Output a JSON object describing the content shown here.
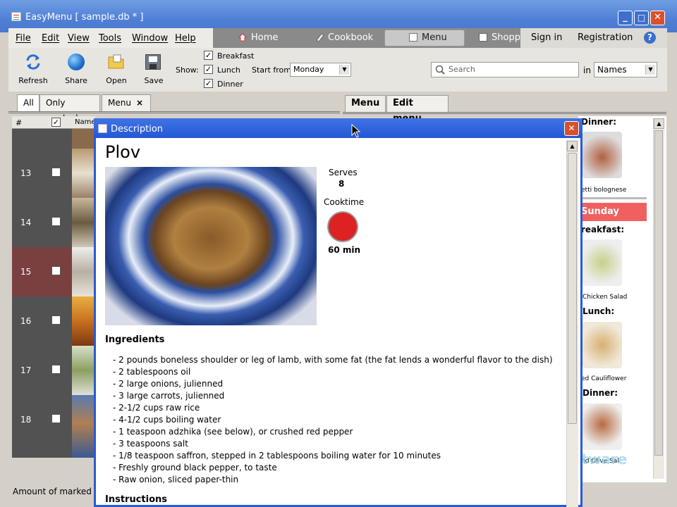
{
  "window": {
    "title": "EasyMenu [ sample.db * ]",
    "minimize": "_",
    "maximize": "□",
    "close": "✕"
  },
  "menubar": [
    "File",
    "Edit",
    "View",
    "Tools",
    "Window",
    "Help"
  ],
  "nav": {
    "home": "Home",
    "cookbook": "Cookbook",
    "menu": "Menu",
    "shopping": "Shoppin",
    "sign_in": "Sign in",
    "registration": "Registration",
    "help": "?"
  },
  "toolbar": {
    "refresh": "Refresh",
    "share": "Share",
    "open": "Open",
    "save": "Save",
    "show_label": "Show:",
    "breakfast": "Breakfast",
    "lunch": "Lunch",
    "dinner": "Dinner",
    "start_from_label": "Start from:",
    "start_from_value": "Monday",
    "search_placeholder": "Search",
    "in_label": "in",
    "in_value": "Names"
  },
  "tabs": {
    "all": "All",
    "only_marked": "Only marked",
    "menu": "Menu",
    "menu_close": "×"
  },
  "grid": {
    "col_num": "#",
    "col_check": "✓",
    "col_name": "Name",
    "rows": [
      "13",
      "14",
      "15",
      "16",
      "17",
      "18"
    ],
    "check": "✓"
  },
  "status": "Amount of marked re",
  "right_tabs": {
    "menu": "Menu",
    "edit_menu": "Edit menu"
  },
  "dialog": {
    "title": "Description",
    "close": "✕",
    "recipe_title": "Plov",
    "serves_label": "Serves",
    "serves_value": "8",
    "cooktime_label": "Cooktime",
    "cooktime_value": "60 min",
    "ingredients_heading": "Ingredients",
    "ingredients": [
      "- 2 pounds boneless shoulder or leg of lamb, with some fat (the fat lends a wonderful flavor to the dish)",
      "- 2 tablespoons oil",
      "- 2 large onions, julienned",
      "- 3 large carrots, julienned",
      "- 2-1/2 cups raw rice",
      "- 4-1/2 cups boiling water",
      "- 1 teaspoon adzhika (see below), or crushed red pepper",
      "- 3 teaspoons salt",
      "- 1/8 teaspoon saffron, stepped in 2 tablespoons boiling water for 10 minutes",
      "- Freshly ground black pepper, to taste",
      "- Raw onion, sliced paper-thin"
    ],
    "instructions_heading": "Instructions"
  },
  "week": {
    "dinner1": "Dinner:",
    "dinner1_caption": "etti bolognese",
    "day": "Sunday",
    "breakfast": "reakfast:",
    "breakfast_caption": "Chicken Salad",
    "lunch": "Lunch:",
    "lunch_caption": "ed Cauliflower",
    "dinner2": "Dinner:",
    "dinner2_caption": "nd Olive Sal"
  },
  "colors": {
    "titlebar": "#4f80d6",
    "dialog_title": "#2458d4",
    "selected_row": "#7a4040",
    "sunday": "#f06060",
    "cooktime": "#dd2222"
  },
  "watermark": "software"
}
